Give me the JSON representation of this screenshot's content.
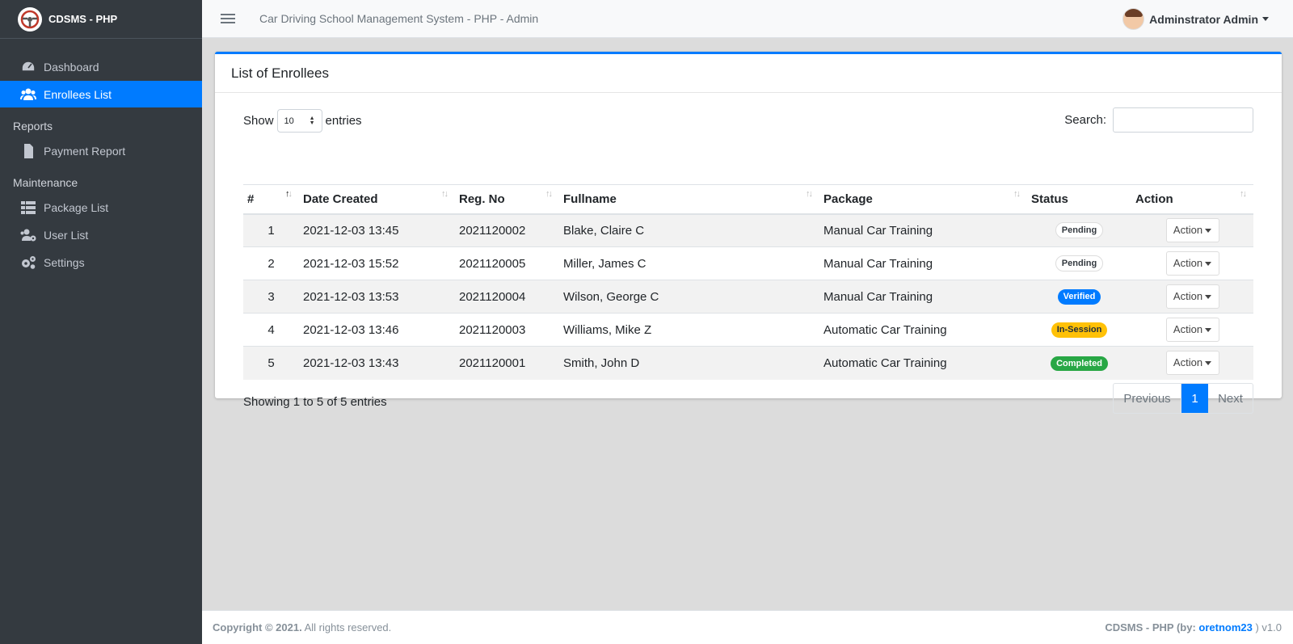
{
  "brand": {
    "name": "CDSMS - PHP"
  },
  "sidebar": {
    "items": [
      {
        "label": "Dashboard",
        "icon": "dashboard-icon"
      },
      {
        "label": "Enrollees List",
        "icon": "users-icon",
        "active": true
      }
    ],
    "reports_header": "Reports",
    "reports": [
      {
        "label": "Payment Report",
        "icon": "file-icon"
      }
    ],
    "maintenance_header": "Maintenance",
    "maintenance": [
      {
        "label": "Package List",
        "icon": "table-icon"
      },
      {
        "label": "User List",
        "icon": "users-cog-icon"
      },
      {
        "label": "Settings",
        "icon": "cogs-icon"
      }
    ]
  },
  "topbar": {
    "title": "Car Driving School Management System - PHP - Admin",
    "user": "Adminstrator Admin"
  },
  "card": {
    "title": "List of Enrollees",
    "show_label": "Show",
    "entries_label": "entries",
    "page_length": "10",
    "search_label": "Search:",
    "search_value": "",
    "columns": [
      "#",
      "Date Created",
      "Reg. No",
      "Fullname",
      "Package",
      "Status",
      "Action"
    ],
    "rows": [
      {
        "n": "1",
        "date": "2021-12-03 13:45",
        "reg": "2021120002",
        "name": "Blake, Claire C",
        "package": "Manual Car Training",
        "status": "Pending",
        "status_type": "light",
        "action": "Action"
      },
      {
        "n": "2",
        "date": "2021-12-03 15:52",
        "reg": "2021120005",
        "name": "Miller, James C",
        "package": "Manual Car Training",
        "status": "Pending",
        "status_type": "light",
        "action": "Action"
      },
      {
        "n": "3",
        "date": "2021-12-03 13:53",
        "reg": "2021120004",
        "name": "Wilson, George C",
        "package": "Manual Car Training",
        "status": "Verified",
        "status_type": "primary",
        "action": "Action"
      },
      {
        "n": "4",
        "date": "2021-12-03 13:46",
        "reg": "2021120003",
        "name": "Williams, Mike Z",
        "package": "Automatic Car Training",
        "status": "In-Session",
        "status_type": "warning",
        "action": "Action"
      },
      {
        "n": "5",
        "date": "2021-12-03 13:43",
        "reg": "2021120001",
        "name": "Smith, John D",
        "package": "Automatic Car Training",
        "status": "Completed",
        "status_type": "success",
        "action": "Action"
      }
    ],
    "info": "Showing 1 to 5 of 5 entries",
    "pager": {
      "prev": "Previous",
      "current": "1",
      "next": "Next"
    }
  },
  "footer": {
    "copyright_bold": "Copyright © 2021.",
    "copyright_rest": " All rights reserved.",
    "credit_prefix": "CDSMS - PHP (by: ",
    "credit_link": "oretnom23",
    "credit_suffix": " ) v1.0"
  },
  "colors": {
    "accent": "#007bff",
    "sidebar": "#343a40",
    "warning": "#ffc107",
    "success": "#28a745"
  }
}
